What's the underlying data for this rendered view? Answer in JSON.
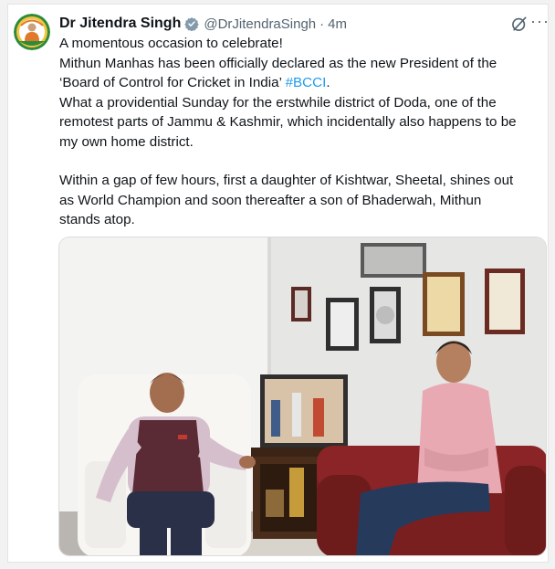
{
  "tweet": {
    "author_name": "Dr Jitendra Singh",
    "handle": "@DrJitendraSingh",
    "separator": "·",
    "time": "4m",
    "more_label": "···",
    "text": {
      "line1": "A momentous occasion to celebrate!",
      "line2": "Mithun Manhas has been officially declared as the new President of the",
      "line3_prefix": "‘Board of Control for Cricket in India’ ",
      "hashtag": "#BCCI",
      "line3_suffix": ".",
      "line4": "What a providential Sunday for the erstwhile district of Doda, one of the",
      "line5": "remotest parts of Jammu & Kashmir, which incidentally also happens to be",
      "line6": "my own home district.",
      "line7": "Within a gap of few hours, first a daughter of Kishtwar, Sheetal, shines out",
      "line8": "as World Champion and soon thereafter a son of Bhaderwah, Mithun",
      "line9": "stands atop."
    }
  },
  "colors": {
    "text": "#0f1419",
    "secondary": "#536471",
    "link": "#1d9bf0",
    "verified": "#829aab"
  }
}
